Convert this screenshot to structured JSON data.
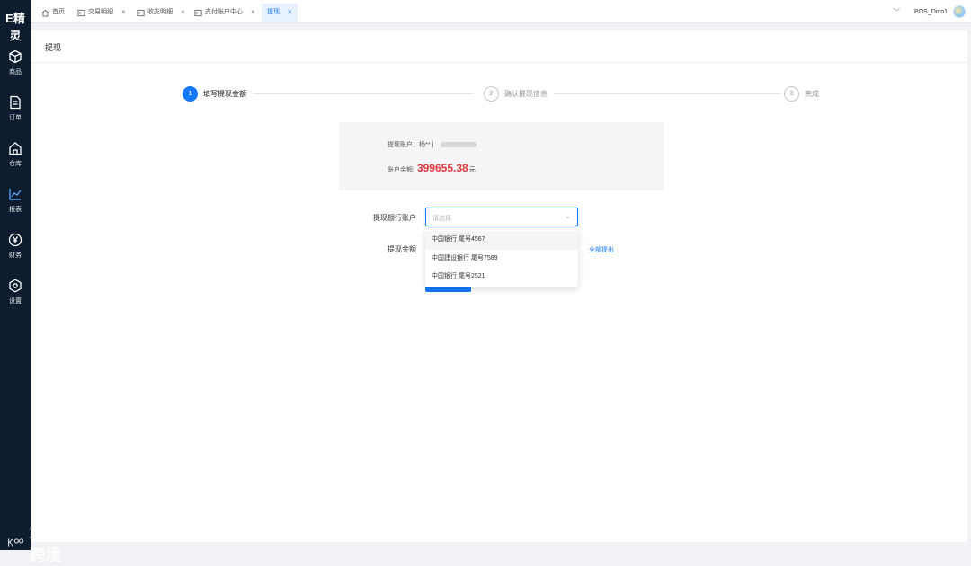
{
  "app": {
    "logo": "E精灵"
  },
  "sidebar": {
    "items": [
      {
        "label": "商品",
        "icon": "cube-icon"
      },
      {
        "label": "订单",
        "icon": "document-icon"
      },
      {
        "label": "仓库",
        "icon": "house-icon"
      },
      {
        "label": "报表",
        "icon": "chart-icon"
      },
      {
        "label": "财务",
        "icon": "yen-coin-icon"
      },
      {
        "label": "设置",
        "icon": "hexagon-gear-icon"
      }
    ]
  },
  "tabs": [
    {
      "label": "首页",
      "icon": "home-icon",
      "closable": false
    },
    {
      "label": "交易明细",
      "icon": "window-icon",
      "closable": true
    },
    {
      "label": "收支明细",
      "icon": "window-icon",
      "closable": true
    },
    {
      "label": "支付账户中心",
      "icon": "window-icon",
      "closable": true
    },
    {
      "label": "提现",
      "closable": true,
      "active": true
    }
  ],
  "header": {
    "username": "POS_Dino1"
  },
  "page": {
    "title": "提现"
  },
  "steps": [
    {
      "number": "1",
      "label": "填写提现金额",
      "active": true
    },
    {
      "number": "2",
      "label": "确认提现信息",
      "active": false
    },
    {
      "number": "3",
      "label": "完成",
      "active": false
    }
  ],
  "account_info": {
    "account_label": "提现账户：",
    "account_name": "杨** |",
    "balance_label": "账户余额:",
    "balance_value": "399655.38",
    "balance_unit": "元"
  },
  "form": {
    "bank_label": "提现银行账户",
    "bank_placeholder": "请选择",
    "amount_label": "提现金额",
    "withdraw_all": "全部提出",
    "bank_options": [
      "中国银行 尾号4567",
      "中国建设银行 尾号7589",
      "中国银行 尾号2521"
    ]
  },
  "watermark": {
    "text": "大数跨境"
  },
  "colors": {
    "accent": "#1677ff",
    "sidebar_bg": "#0d1c2e",
    "balance": "#e4393c"
  }
}
